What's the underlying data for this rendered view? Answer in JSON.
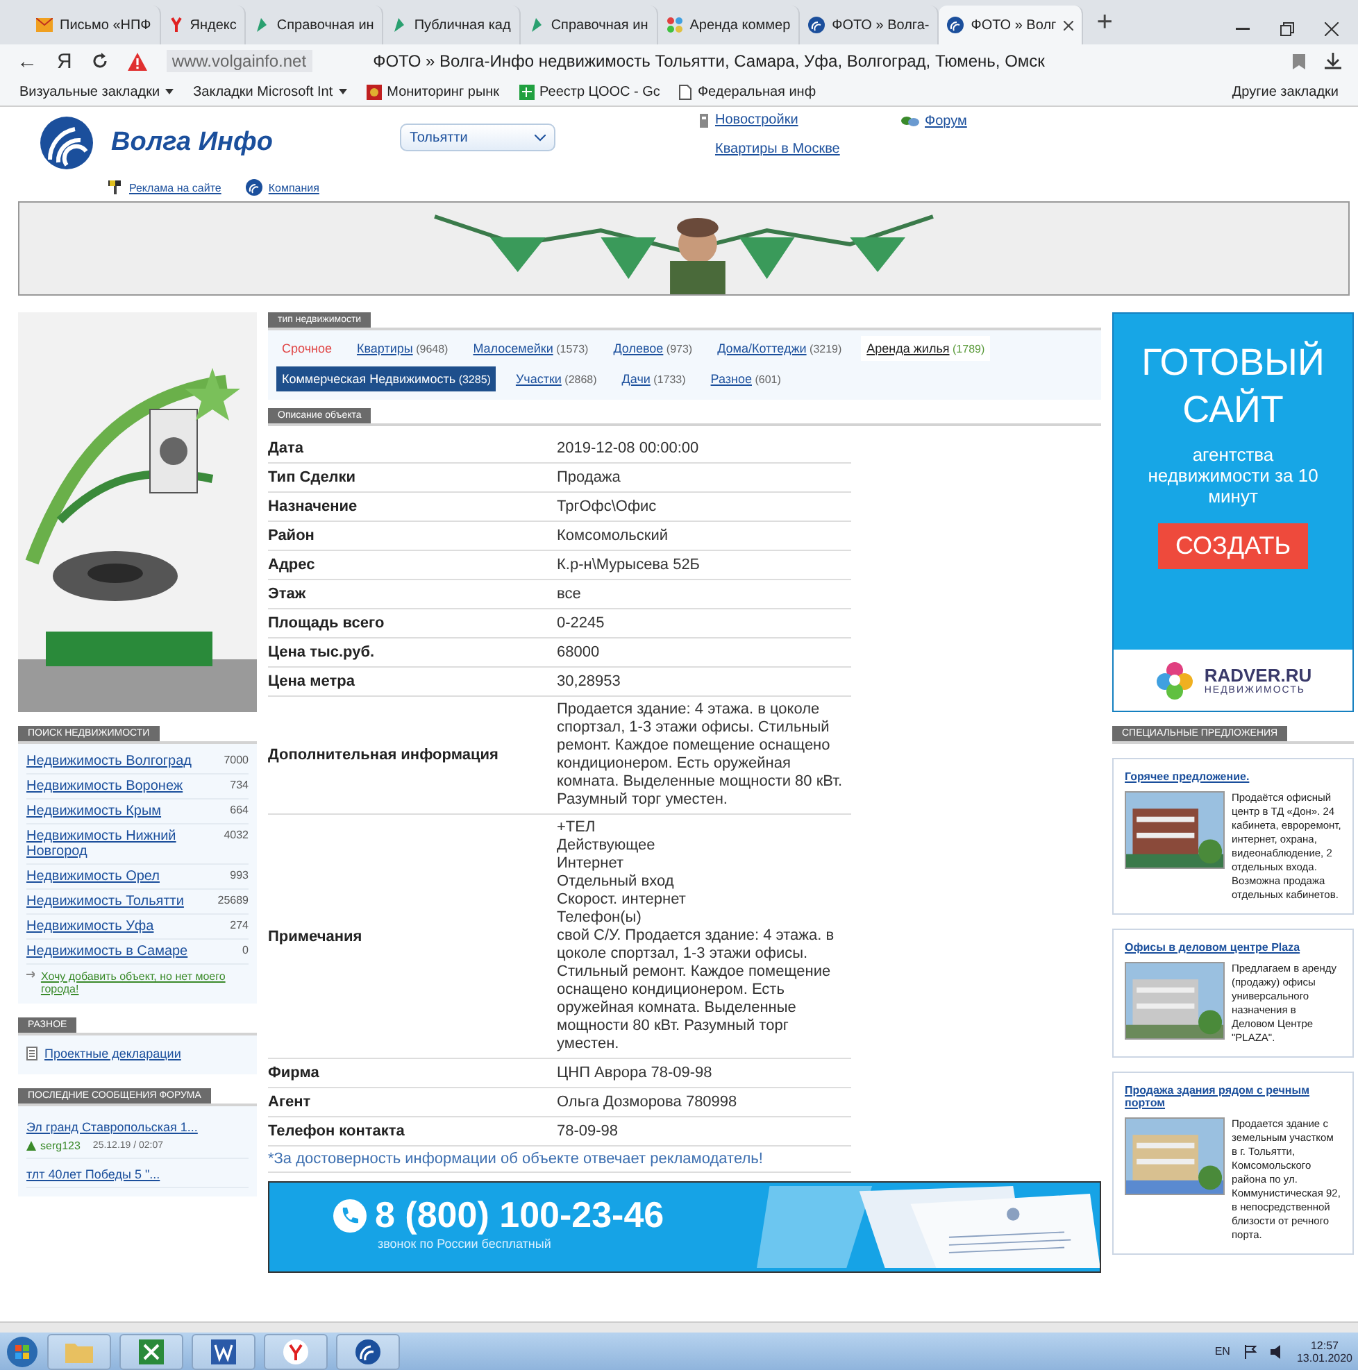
{
  "browser": {
    "tabs": [
      {
        "title": "Письмо «НПФ",
        "kind": "mail",
        "selected": false
      },
      {
        "title": "Яндекс",
        "kind": "yandex",
        "selected": false
      },
      {
        "title": "Справочная ин",
        "kind": "leaf",
        "selected": false
      },
      {
        "title": "Публичная кад",
        "kind": "leaf",
        "selected": false
      },
      {
        "title": "Справочная ин",
        "kind": "leaf",
        "selected": false
      },
      {
        "title": "Аренда коммер",
        "kind": "dots",
        "selected": false
      },
      {
        "title": "ФОТО » Волга-",
        "kind": "volga",
        "selected": false
      },
      {
        "title": "ФОТО » Волг",
        "kind": "volga",
        "selected": true
      }
    ],
    "new_tab": "+",
    "back_glyph": "←",
    "ya_glyph": "Я",
    "address": {
      "domain": "www.volgainfo.net",
      "title": "ФОТО » Волга-Инфо недвижимость Тольятти, Самара, Уфа, Волгоград, Тюмень, Омск"
    },
    "bookmarks": [
      {
        "label": "Визуальные закладки",
        "kind": "folder",
        "dropdown": true
      },
      {
        "label": "Закладки Microsoft Int",
        "kind": "folder",
        "dropdown": true
      },
      {
        "label": "Мониторинг рынк",
        "kind": "crest",
        "dropdown": false
      },
      {
        "label": "Реестр ЦООС - Gc",
        "kind": "sheet",
        "dropdown": false
      },
      {
        "label": "Федеральная инф",
        "kind": "page",
        "dropdown": false
      }
    ],
    "other_bookmarks": "Другие закладки"
  },
  "header": {
    "logo_text": "Волга Инфо",
    "city": "Тольятти",
    "links": [
      {
        "label": "Новостройки",
        "kind": "building"
      },
      {
        "label": "Форум",
        "kind": "chat"
      },
      {
        "label": "Квартиры в Москве",
        "kind": "plain"
      }
    ],
    "sub_links": [
      {
        "label": "Реклама на сайте",
        "kind": "paint"
      },
      {
        "label": "Компания",
        "kind": "volga"
      }
    ]
  },
  "left": {
    "search": {
      "title": "ПОИСК НЕДВИЖИМОСТИ",
      "items": [
        {
          "label": "Недвижимость Волгоград",
          "count": "7000"
        },
        {
          "label": "Недвижимость Воронеж",
          "count": "734"
        },
        {
          "label": "Недвижимость Крым",
          "count": "664"
        },
        {
          "label": "Недвижимость Нижний Новгород",
          "count": "4032"
        },
        {
          "label": "Недвижимость Орел",
          "count": "993"
        },
        {
          "label": "Недвижимость Тольятти",
          "count": "25689"
        },
        {
          "label": "Недвижимость Уфа",
          "count": "274"
        },
        {
          "label": "Недвижимость в Самаре",
          "count": "0"
        }
      ],
      "add_link": "Хочу добавить объект, но нет моего города!"
    },
    "misc": {
      "title": "РАЗНОЕ",
      "items": [
        "Проектные декларации"
      ]
    },
    "forum": {
      "title": "ПОСЛЕДНИЕ СООБЩЕНИЯ ФОРУМА",
      "posts": [
        {
          "topic": "Эл гранд Ставропольская 1...",
          "user": "serg123",
          "time": "25.12.19 / 02:07"
        },
        {
          "topic": "тлт 40лет Победы 5 \"..."
        }
      ]
    }
  },
  "types": {
    "title": "тип недвижимости",
    "items": [
      {
        "label": "Срочное",
        "kind": "urgent",
        "selected": false
      },
      {
        "label": "Квартиры",
        "count": "(9648)",
        "kind": "link",
        "selected": false
      },
      {
        "label": "Малосемейки",
        "count": "(1573)",
        "kind": "link",
        "selected": false
      },
      {
        "label": "Долевое",
        "count": "(973)",
        "kind": "link",
        "selected": false
      },
      {
        "label": "Дома/Коттеджи",
        "count": "(3219)",
        "kind": "link",
        "selected": false
      },
      {
        "label": "Аренда жилья",
        "count": "(1789)",
        "kind": "rent",
        "selected": false
      },
      {
        "label": "Коммерческая Недвижимость",
        "count": "(3285)",
        "kind": "link",
        "selected": true
      },
      {
        "label": "Участки",
        "count": "(2868)",
        "kind": "link",
        "selected": false
      },
      {
        "label": "Дачи",
        "count": "(1733)",
        "kind": "link",
        "selected": false
      },
      {
        "label": "Разное",
        "count": "(601)",
        "kind": "link",
        "selected": false
      }
    ]
  },
  "description": {
    "title": "Описание объекта",
    "rows": [
      {
        "label": "Дата",
        "value": "2019-12-08 00:00:00"
      },
      {
        "label": "Тип Сделки",
        "value": "Продажа"
      },
      {
        "label": "Назначение",
        "value": "ТргОфс\\Офис"
      },
      {
        "label": "Район",
        "value": "Комсомольский"
      },
      {
        "label": "Адрес",
        "value": "К.р-н\\Мурысева 52Б"
      },
      {
        "label": "Этаж",
        "value": "все"
      },
      {
        "label": "Площадь всего",
        "value": "0-2245"
      },
      {
        "label": "Цена тыс.руб.",
        "value": "68000"
      },
      {
        "label": "Цена метра",
        "value": "30,28953"
      },
      {
        "label": "Дополнительная информация",
        "value": "Продается здание: 4 этажа. в цоколе спортзал, 1-3 этажи офисы. Стильный ремонт. Каждое помещение оснащено кондиционером. Есть оружейная комната. Выделенные мощности 80 кВт. Разумный торг уместен."
      },
      {
        "label": "Примечания",
        "value": "+ТЕЛ\nДействующее\nИнтернет\nОтдельный вход\nСкорост. интернет\nТелефон(ы)\nсвой С/У. Продается здание: 4 этажа. в цоколе спортзал, 1-3 этажи офисы. Стильный ремонт. Каждое помещение оснащено кондиционером. Есть оружейная комната. Выделенные мощности 80 кВт. Разумный торг уместен."
      },
      {
        "label": "Фирма",
        "value": "ЦНП Аврора 78-09-98"
      },
      {
        "label": "Агент",
        "value": "Ольга Дозморова 780998"
      },
      {
        "label": "Телефон контакта",
        "value": "78-09-98"
      }
    ],
    "disclaimer": "*За достоверность информации об объекте отвечает рекламодатель!"
  },
  "phone_banner": {
    "phone": "8 (800) 100-23-46",
    "note": "звонок по России бесплатный"
  },
  "right": {
    "ad": {
      "headline": "ГОТОВЫЙ САЙТ",
      "line": "агентства недвижимости за 10 минут",
      "button": "СОЗДАТЬ",
      "brand": "RADVER.RU",
      "brand_sub": "НЕДВИЖИМОСТЬ"
    },
    "offers": {
      "title": "СПЕЦИАЛЬНЫЕ ПРЕДЛОЖЕНИЯ",
      "items": [
        {
          "title": "Горячее предложение.",
          "text": "Продаётся офисный центр в ТД «Дон». 24 кабинета, евроремонт, интернет, охрана, видеонаблюдение, 2 отдельных входа. Возможна продажа отдельных кабинетов."
        },
        {
          "title": "Офисы в деловом центре Plaza",
          "text": "Предлагаем в аренду (продажу) офисы универсального назначения в Деловом Центре \"PLAZA\"."
        },
        {
          "title": "Продажа здания рядом с речным портом",
          "text": "Продается здание с земельным участком в г. Тольятти, Комсомольского района по ул. Коммунистическая 92, в непосредственной близости от речного порта."
        }
      ]
    }
  },
  "taskbar": {
    "apps": [
      {
        "kind": "start"
      },
      {
        "kind": "folder"
      },
      {
        "kind": "excel"
      },
      {
        "kind": "word"
      },
      {
        "kind": "yandex"
      },
      {
        "kind": "volga"
      }
    ],
    "lang": "EN",
    "time": "12:57",
    "date": "13.01.2020"
  }
}
